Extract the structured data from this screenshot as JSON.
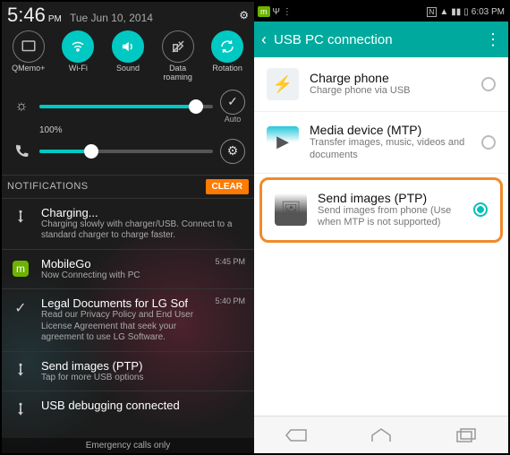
{
  "left": {
    "status": {
      "time": "5:46",
      "ampm": "PM",
      "date": "Tue Jun 10, 2014"
    },
    "toggles": [
      {
        "label": "QMemo+",
        "on": false,
        "icon": "memo"
      },
      {
        "label": "Wi-Fi",
        "on": true,
        "icon": "wifi"
      },
      {
        "label": "Sound",
        "on": true,
        "icon": "sound"
      },
      {
        "label": "Data roaming",
        "on": false,
        "icon": "roaming"
      },
      {
        "label": "Rotation",
        "on": true,
        "icon": "rotation"
      }
    ],
    "brightness": {
      "value_pct": 90,
      "label": "100%",
      "auto_label": "Auto"
    },
    "volume": {
      "value_pct": 30
    },
    "notifications_header": "NOTIFICATIONS",
    "clear_label": "CLEAR",
    "items": [
      {
        "icon": "usb",
        "title": "Charging...",
        "sub": "Charging slowly with charger/USB. Connect to a standard charger to charge faster.",
        "when": ""
      },
      {
        "icon": "mobilego",
        "title": "MobileGo",
        "sub": "Now Connecting with PC",
        "when": "5:45 PM"
      },
      {
        "icon": "check",
        "title": "Legal Documents for LG Sof",
        "sub": "Read our Privacy Policy and End User License Agreement that seek your agreement to use LG Software.",
        "when": "5:40 PM"
      },
      {
        "icon": "usb",
        "title": "Send images (PTP)",
        "sub": "Tap for more USB options",
        "when": ""
      },
      {
        "icon": "usb",
        "title": "USB debugging connected",
        "sub": "",
        "when": ""
      }
    ],
    "footer": "Emergency calls only"
  },
  "right": {
    "status": {
      "time": "6:03 PM"
    },
    "header": {
      "title": "USB PC connection"
    },
    "options": [
      {
        "title": "Charge phone",
        "sub": "Charge phone via USB",
        "selected": false,
        "highlight": false
      },
      {
        "title": "Media device (MTP)",
        "sub": "Transfer images, music, videos and documents",
        "selected": false,
        "highlight": false
      },
      {
        "title": "Send images (PTP)",
        "sub": "Send images from phone (Use when MTP is not supported)",
        "selected": true,
        "highlight": true
      }
    ]
  }
}
